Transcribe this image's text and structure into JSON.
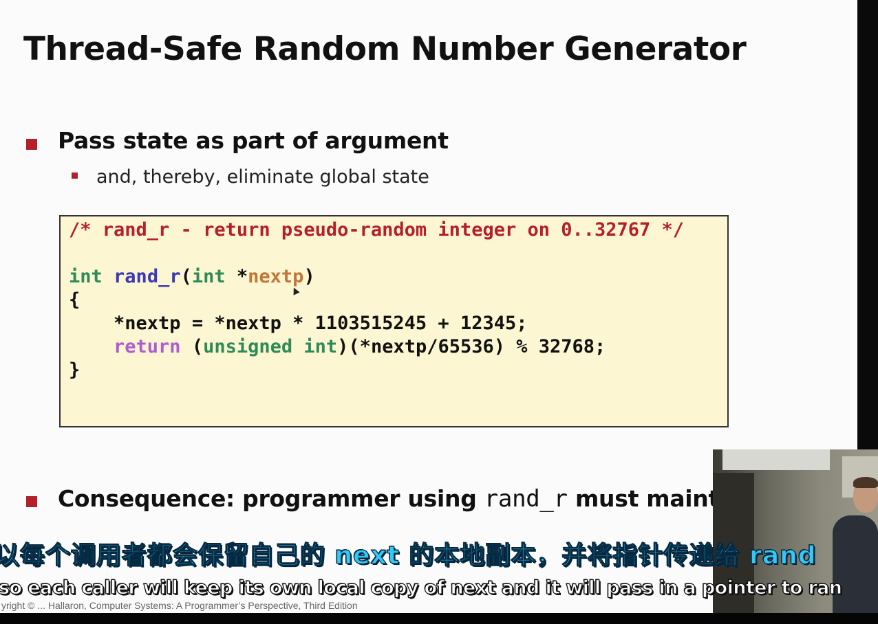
{
  "slide": {
    "title": "Thread-Safe Random Number Generator",
    "bullet1": "Pass state as part of argument",
    "sub_bullet1": "and, thereby, eliminate global state",
    "code": {
      "comment": "/* rand_r - return pseudo-random integer on 0..32767 */",
      "sig_type": "int",
      "sig_func": "rand_r",
      "sig_open": "(",
      "sig_param_type": "int",
      "sig_ptr": " *",
      "sig_param": "nextp",
      "sig_close": ")",
      "open_brace": "{",
      "line1": "*nextp = *nextp * 1103515245 + 12345;",
      "ret_kw": "return",
      "ret_open": " (",
      "ret_cast": "unsigned int",
      "ret_rest": ")(*nextp/65536) % 32768;",
      "close_brace": "}"
    },
    "bullet2_prefix": "Consequence: programmer using ",
    "bullet2_code": "rand_r",
    "bullet2_suffix": " must maint",
    "footer": "yright © ... Hallaron, Computer Systems: A Programmer’s Perspective, Third Edition"
  },
  "subtitles": {
    "chinese": "以每个调用者都会保留自己的 next 的本地副本，并将指针传递给 rand",
    "english": "so each caller will keep its own local copy of next and it will pass in a pointer to ran"
  },
  "colors": {
    "accent": "#b3202a",
    "code_background": "#fcf6d2",
    "subtitle_chinese": "#33c9f5"
  }
}
